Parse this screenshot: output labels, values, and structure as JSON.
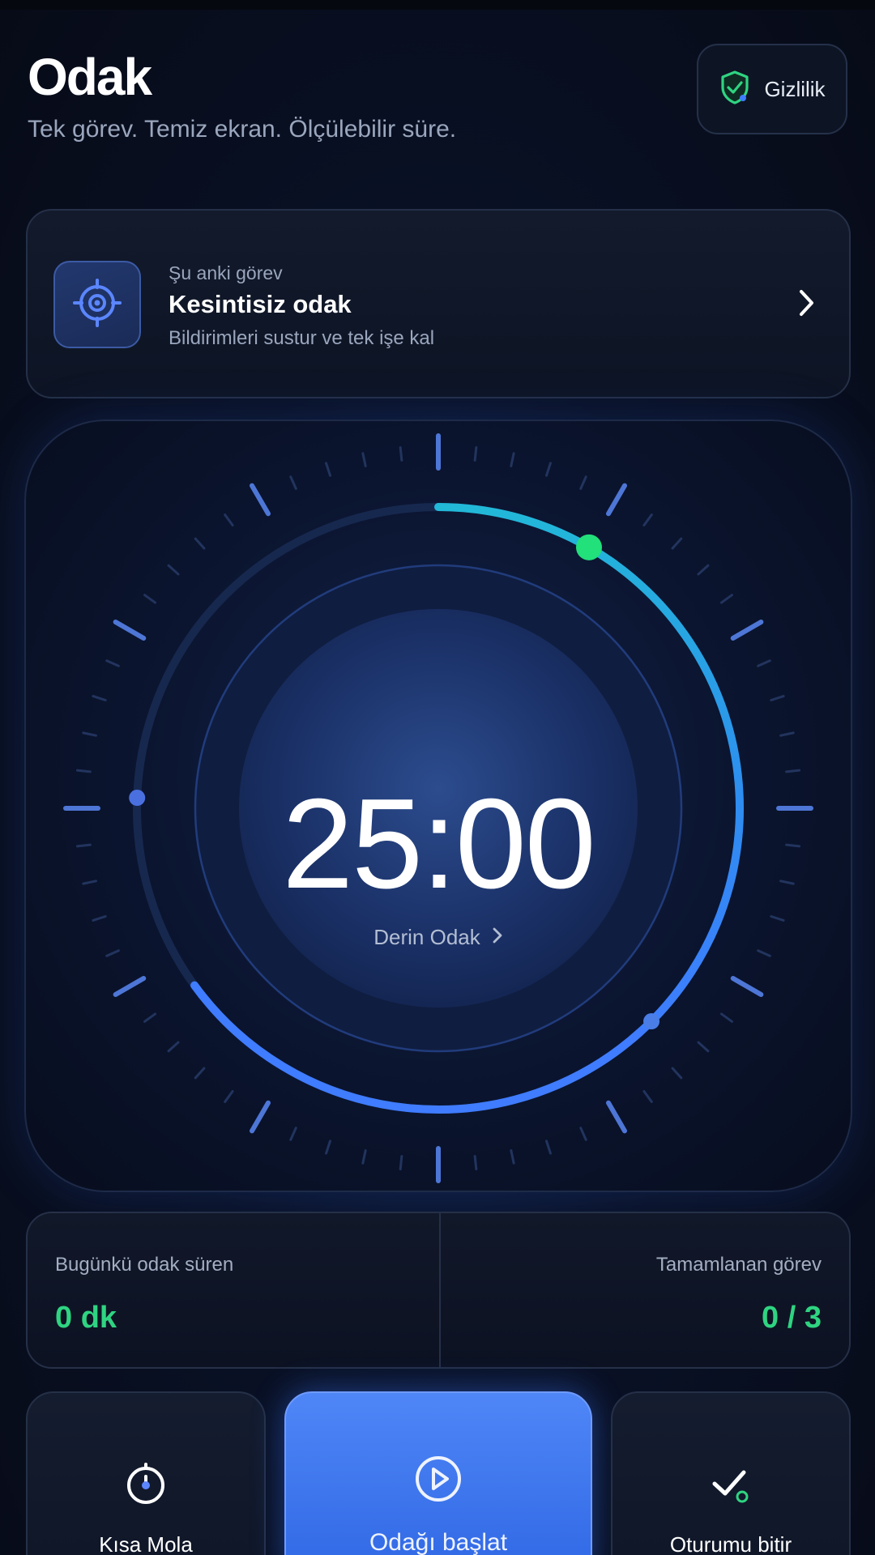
{
  "header": {
    "title": "Odak",
    "subtitle": "Tek görev. Temiz ekran. Ölçülebilir süre.",
    "privacy_label": "Gizlilik"
  },
  "current_task": {
    "eyebrow": "Şu anki görev",
    "title": "Kesintisiz odak",
    "description": "Bildirimleri sustur ve tek işe kal"
  },
  "timer": {
    "time": "25:00",
    "mode": "Derin Odak",
    "accent_start": "#22b8d8",
    "accent_end": "#3f7cff",
    "knob_color": "#22e07a"
  },
  "stats": {
    "focus_label": "Bugünkü odak süren",
    "focus_value": "0 dk",
    "tasks_label": "Tamamlanan görev",
    "tasks_value": "0 / 3"
  },
  "actions": {
    "short_break": "Kısa Mola",
    "start_focus": "Odağı başlat",
    "end_session": "Oturumu bitir"
  },
  "colors": {
    "background": "#080d1a",
    "accent_green": "#2fd481",
    "primary_blue": "#3f7cff"
  },
  "icons": {
    "privacy": "shield-check-icon",
    "task": "target-icon",
    "task_nav": "chevron-right-icon",
    "mode_nav": "chevron-right-icon",
    "short_break": "stopwatch-icon",
    "start": "play-icon",
    "end": "check-icon"
  }
}
